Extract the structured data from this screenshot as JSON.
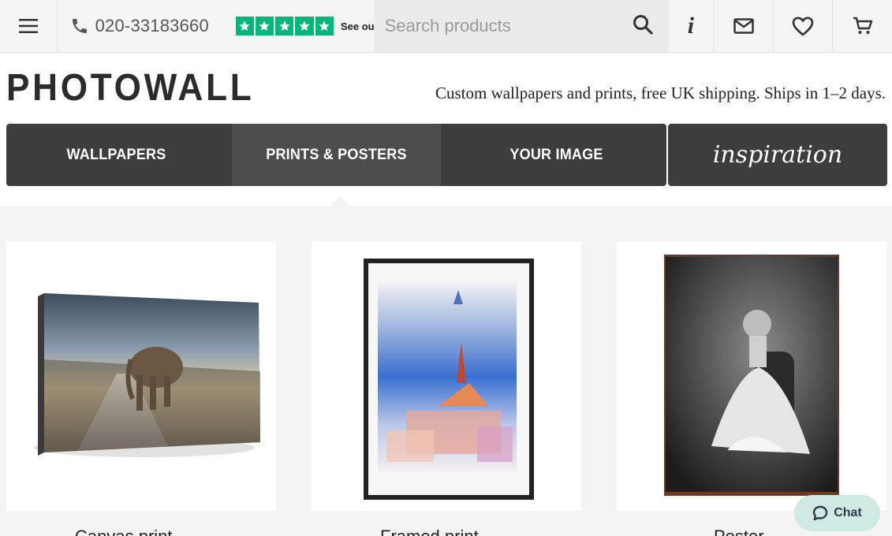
{
  "topbar": {
    "menu_icon": "hamburger-icon",
    "phone_icon": "phone-icon",
    "phone": "020-33183660",
    "trustpilot_stars": 5,
    "trustpilot_text": "See ou",
    "search_placeholder": "Search products",
    "search_icon": "search-icon",
    "info_label": "i",
    "mail_icon": "mail-icon",
    "heart_icon": "heart-icon",
    "cart_icon": "cart-icon"
  },
  "brand": {
    "logo": "PHOTOWALL",
    "tagline": "Custom wallpapers and prints, free UK shipping. Ships in 1–2 days."
  },
  "nav": {
    "tabs": [
      {
        "label": "WALLPAPERS",
        "active": false
      },
      {
        "label": "PRINTS & POSTERS",
        "active": true
      },
      {
        "label": "YOUR IMAGE",
        "active": false
      }
    ],
    "inspiration": "inspiration"
  },
  "products": [
    {
      "title": "Canvas print",
      "image": "canvas print of elephant walking on road"
    },
    {
      "title": "Framed print",
      "image": "framed watercolour print of city"
    },
    {
      "title": "Poster",
      "image": "black and white poster of ballerina in hanger"
    }
  ],
  "chat": {
    "label": "Chat",
    "icon": "chat-bubble-icon"
  },
  "colors": {
    "nav_bg": "#3d3d3d",
    "nav_active": "#4d4d4d",
    "trustpilot": "#00b67a",
    "chat_bg": "#cfe9e3"
  }
}
